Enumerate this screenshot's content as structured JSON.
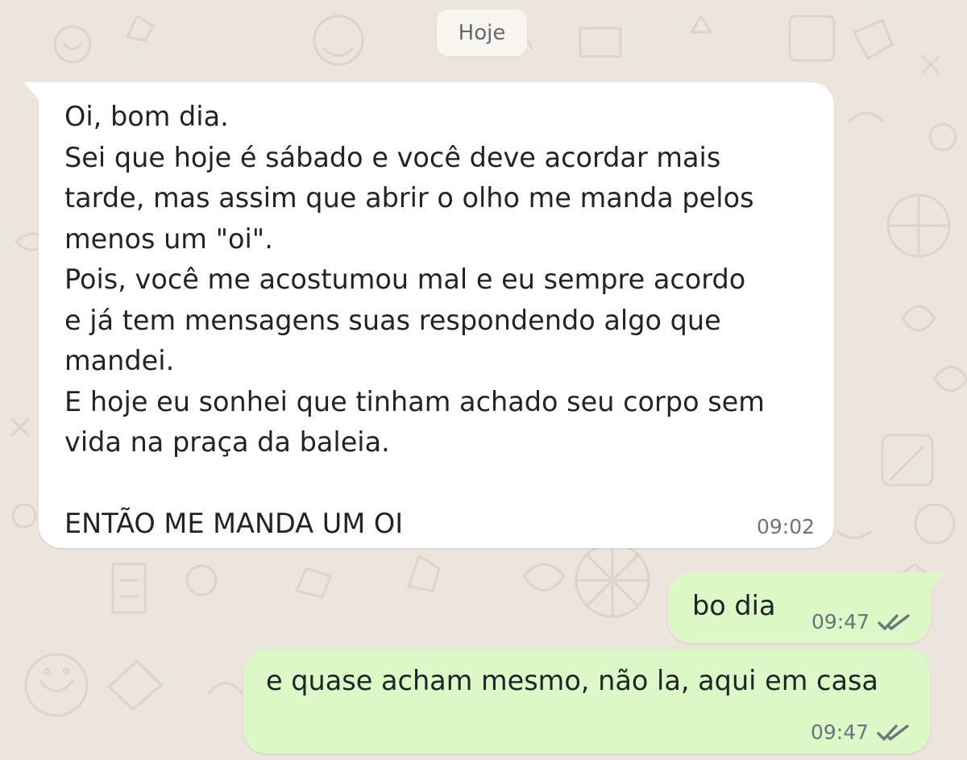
{
  "chat": {
    "date_label": "Hoje",
    "incoming_message": {
      "text": "Oi, bom dia.\nSei que hoje é sábado e você deve acordar mais\ntarde, mas assim que abrir o olho me manda pelos\nmenos um \"oi\".\nPois, você me acostumou mal e eu sempre acordo\ne já tem mensagens suas respondendo algo que\nmandei.\nE hoje eu sonhei que tinham achado seu corpo sem\nvida na praça da baleia.\n\nENTÃO ME MANDA UM OI",
      "time": "09:02"
    },
    "outgoing_messages": [
      {
        "text": "bo dia",
        "time": "09:47",
        "status_icon": "double-check-icon"
      },
      {
        "text": "e quase acham mesmo, não la, aqui em casa",
        "time": "09:47",
        "status_icon": "double-check-icon"
      }
    ]
  },
  "colors": {
    "wallpaper": "#ece5dd",
    "incoming_bubble": "#ffffff",
    "outgoing_bubble": "#dcf8c6",
    "date_chip": "#f8f5f1",
    "text": "#1f2426",
    "timestamp": "#68757b"
  }
}
